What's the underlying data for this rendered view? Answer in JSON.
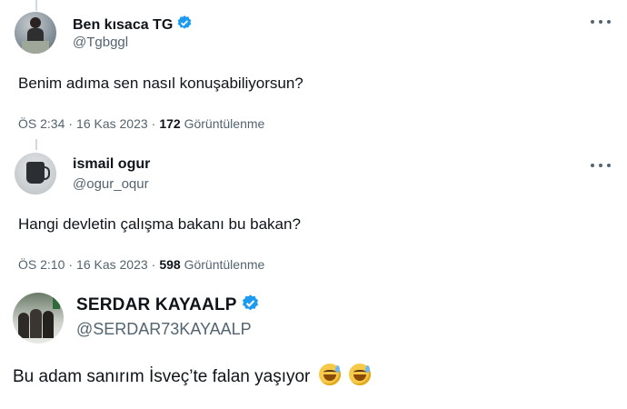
{
  "tweets": [
    {
      "display_name": "Ben kısaca TG",
      "handle": "@Tgbggl",
      "text": "Benim adıma sen nasıl konuşabiliyorsun?",
      "time": "ÖS 2:34",
      "date": "16 Kas 2023",
      "views_count": "172",
      "views_label": "Görüntülenme",
      "verified": true
    },
    {
      "display_name": "ismail ogur",
      "handle": "@ogur_oqur",
      "text": "Hangi devletin çalışma bakanı bu bakan?",
      "time": "ÖS 2:10",
      "date": "16 Kas 2023",
      "views_count": "598",
      "views_label": "Görüntülenme",
      "verified": false
    },
    {
      "display_name": "SERDAR KAYAALP",
      "handle": "@SERDAR73KAYAALP",
      "text": "Bu adam sanırım İsveç’te falan yaşıyor",
      "verified": true
    }
  ],
  "separator": "·",
  "colors": {
    "verified": "#1d9bf0",
    "muted": "#536471",
    "text": "#0f1419",
    "thread_line": "#cfd9de"
  },
  "icons": [
    "more-icon",
    "verified-badge-icon",
    "grinning-sweat-emoji"
  ]
}
